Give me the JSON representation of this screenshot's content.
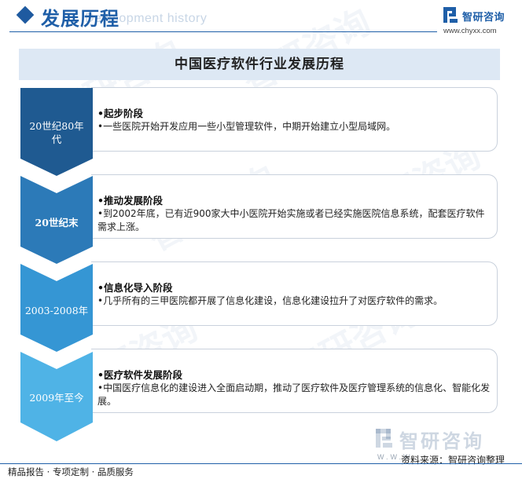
{
  "header": {
    "title": "发展历程",
    "subtitle_en": "Development history",
    "logo_name": "智研咨询",
    "logo_url": "www.chyxx.com"
  },
  "diagram": {
    "title": "中国医疗软件行业发展历程",
    "stages": [
      {
        "period": "20世纪80年代",
        "heading": "•起步阶段",
        "description": "•一些医院开始开发应用一些小型管理软件，中期开始建立小型局域网。",
        "color": "#1f5a91"
      },
      {
        "period": "20世纪末",
        "heading": "•推动发展阶段",
        "description": "•到2002年底，已有近900家大中小医院开始实施或者已经实施医院信息系统，配套医疗软件需求上涨。",
        "color": "#2c7ab8"
      },
      {
        "period": "2003-2008年",
        "heading": "•信息化导入阶段",
        "description": "•几乎所有的三甲医院都开展了信息化建设，信息化建设拉升了对医疗软件的需求。",
        "color": "#3596d4"
      },
      {
        "period": "2009年至今",
        "heading": "•医疗软件发展阶段",
        "description": "•中国医疗信息化的建设进入全面启动期，推动了医疗软件及医疗管理系统的信息化、智能化发展。",
        "color": "#4fb3e6"
      }
    ]
  },
  "footer": {
    "logo_name": "智研咨询",
    "www": "W.W.W",
    "source": "资料来源：智研咨询整理",
    "tagline": "精品报告 · 专项定制 · 品质服务"
  },
  "colors": {
    "brand": "#1f5fa8",
    "title_bar": "#dde8f4"
  }
}
